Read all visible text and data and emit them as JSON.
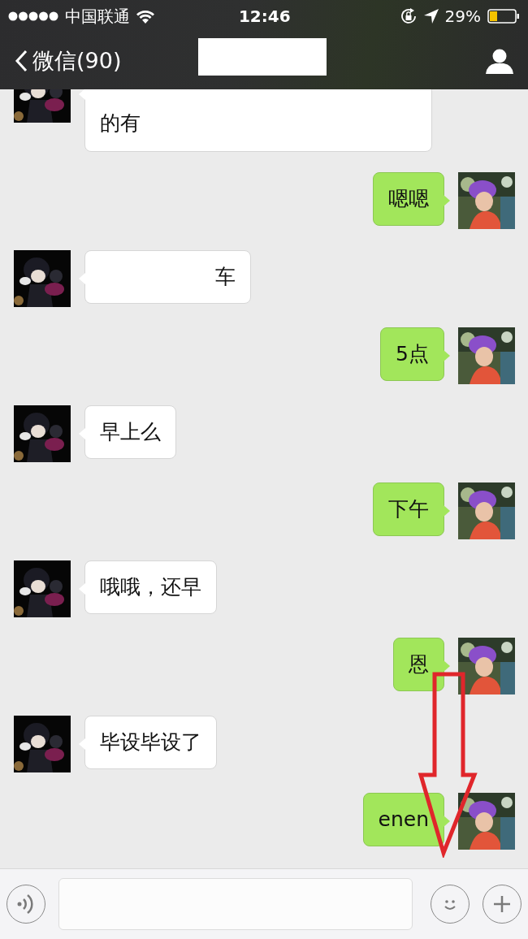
{
  "status_bar": {
    "carrier": "中国联通",
    "time": "12:46",
    "battery": "29%"
  },
  "nav": {
    "back_label": "微信(90)",
    "title_hidden": true
  },
  "messages": [
    {
      "outgoing": false,
      "kind": "twoline",
      "text": "的有"
    },
    {
      "outgoing": true,
      "kind": "plain",
      "text": "嗯嗯"
    },
    {
      "outgoing": false,
      "kind": "covered",
      "text": "车"
    },
    {
      "outgoing": true,
      "kind": "plain",
      "text": "5点"
    },
    {
      "outgoing": false,
      "kind": "plain",
      "text": "早上么"
    },
    {
      "outgoing": true,
      "kind": "plain",
      "text": "下午"
    },
    {
      "outgoing": false,
      "kind": "plain",
      "text": "哦哦，还早"
    },
    {
      "outgoing": true,
      "kind": "plain",
      "text": "恩"
    },
    {
      "outgoing": false,
      "kind": "plain",
      "text": "毕设毕设了"
    },
    {
      "outgoing": true,
      "kind": "plain",
      "text": "enen"
    }
  ],
  "annotation": {
    "kind": "arrow"
  }
}
